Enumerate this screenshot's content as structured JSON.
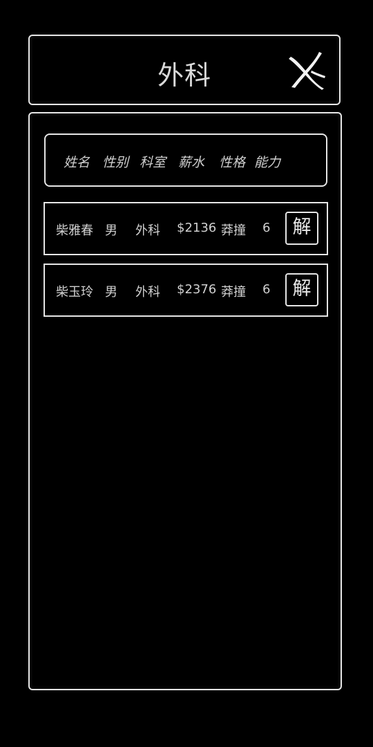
{
  "dialog": {
    "title": "外科"
  },
  "table": {
    "headers": [
      "姓名",
      "性别",
      "科室",
      "薪水",
      "性格",
      "能力"
    ],
    "rows": [
      {
        "name": "柴雅春",
        "gender": "男",
        "department": "外科",
        "salary": "$2136",
        "personality": "莽撞",
        "ability": "6",
        "action_label": "解"
      },
      {
        "name": "柴玉玲",
        "gender": "男",
        "department": "外科",
        "salary": "$2376",
        "personality": "莽撞",
        "ability": "6",
        "action_label": "解"
      }
    ]
  },
  "icons": {
    "close": "close-x-brush-icon"
  },
  "colors": {
    "background": "#000000",
    "border": "#e6e6e6",
    "text": "#d0d0d0"
  }
}
